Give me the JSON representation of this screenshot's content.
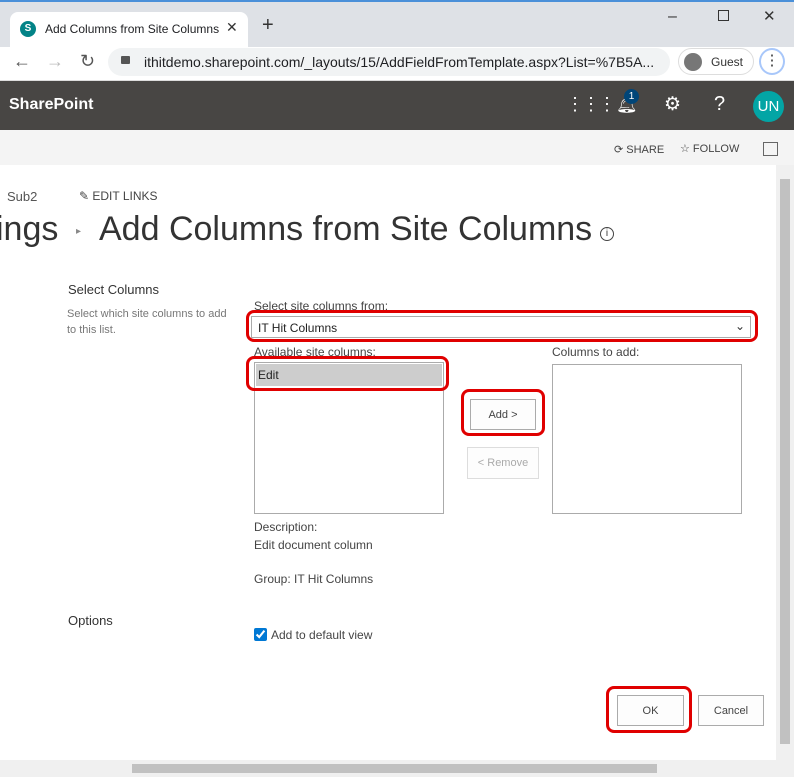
{
  "browser": {
    "tab_title": "Add Columns from Site Columns",
    "url": "ithitdemo.sharepoint.com/_layouts/15/AddFieldFromTemplate.aspx?List=%7B5A...",
    "profile": "Guest"
  },
  "suitebar": {
    "app_name": "SharePoint",
    "notification_count": "1",
    "avatar": "UN",
    "avatar_color": "#03a5a5"
  },
  "actions": {
    "share": "SHARE",
    "follow": "FOLLOW"
  },
  "nav": {
    "site": "Sub2",
    "edit_links": "EDIT LINKS"
  },
  "page": {
    "breadcrumb_prev": "ings",
    "title": "Add Columns from Site Columns"
  },
  "section": {
    "title": "Select Columns",
    "description": "Select which site columns to add to this list."
  },
  "form": {
    "select_from_label": "Select site columns from:",
    "select_from_value": "IT Hit Columns",
    "available_label": "Available site columns:",
    "available_items": [
      "Edit"
    ],
    "to_add_label": "Columns to add:",
    "add_button": "Add >",
    "remove_button": "< Remove",
    "description_label": "Description:",
    "description_value": "Edit document column",
    "group": "Group: IT Hit Columns"
  },
  "options": {
    "title": "Options",
    "add_default_view": "Add to default view",
    "add_default_view_checked": true
  },
  "footer": {
    "ok": "OK",
    "cancel": "Cancel"
  },
  "highlight_color": "#e00000"
}
